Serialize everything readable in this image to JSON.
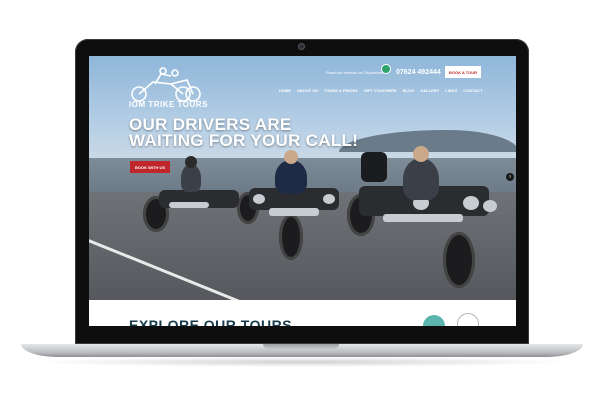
{
  "site": {
    "logo_text": "IOM TRIKE TOURS",
    "reviews_text": "Read our reviews on Tripadvisor",
    "phone": "07624 492444",
    "book_tour_label": "BOOK A TOUR",
    "nav": [
      "HOME",
      "ABOUT US",
      "TOURS & PRICES",
      "GIFT VOUCHERS",
      "BLOG",
      "GALLERY",
      "LINKS",
      "CONTACT"
    ],
    "headline_line1": "OUR DRIVERS ARE",
    "headline_line2": "WAITING FOR YOUR CALL!",
    "book_us_label": "BOOK WITH US",
    "slider_next_glyph": "›",
    "section_title": "EXPLORE OUR TOURS"
  },
  "colors": {
    "brand_red": "#c0272d",
    "heading_navy": "#16394a",
    "badge_teal": "#5bb5ae",
    "bezel": "#0e0e0f"
  },
  "icons": [
    "trike-logo-icon",
    "tripadvisor-owl-icon",
    "camera-icon",
    "slider-next-icon"
  ]
}
